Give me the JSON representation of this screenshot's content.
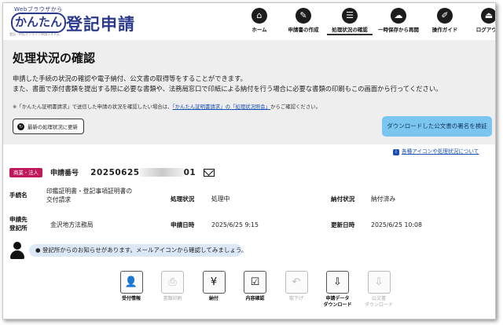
{
  "header": {
    "logo_small": "Webブラウザから",
    "logo_kantan": "かんたん",
    "logo_main": "登記申請",
    "logo_tiny": "登記・供託オンライン申請システム",
    "nav": [
      {
        "label": "ホーム",
        "icon": "home-icon"
      },
      {
        "label": "申請書の作成",
        "icon": "document-edit-icon"
      },
      {
        "label": "処理状況の確認",
        "icon": "list-check-icon",
        "active": true
      },
      {
        "label": "一時保存から再開",
        "icon": "cloud-download-icon"
      },
      {
        "label": "操作ガイド",
        "icon": "book-icon"
      },
      {
        "label": "ログアウト",
        "icon": "logout-icon"
      }
    ]
  },
  "page": {
    "title": "処理状況の確認",
    "desc_line1": "申請した手続の状況の確認や電子納付、公文書の取得等をすることができます。",
    "desc_line2": "また、書面で添付書類を提出する際に必要な書類や、法務局窓口で印紙による納付を行う場合に必要な書類の印刷もこの画面から行ってください。",
    "note_prefix": "※「かんたん証明書請求」で送信した申請の状況を確認したい場合は、",
    "note_link": "「かんたん証明書請求」の「処理状況照会」",
    "note_suffix": "からご確認ください。",
    "refresh_button": "最新の処理状況に更新",
    "verify_button": "ダウンロードした公文書の署名を検証",
    "help_link": "各種アイコンや処理状況について"
  },
  "application": {
    "badge": "商業・法人",
    "number_label": "申請番号",
    "number_prefix": "20250625",
    "number_suffix": "01",
    "fields": {
      "procedure_label": "手続名",
      "procedure_value_1": "印鑑証明書・登記事項証明書の",
      "procedure_value_2": "交付請求",
      "status_label": "処理状況",
      "status_value": "処理中",
      "payment_label": "納付状況",
      "payment_value": "納付済み",
      "office_label_1": "申請先",
      "office_label_2": "登記所",
      "office_value": "金沢地方法務局",
      "applied_label": "申請日時",
      "applied_value": "2025/6/25 9:15",
      "updated_label": "更新日時",
      "updated_value": "2025/6/25 10:08"
    },
    "notice": "登記所からのお知らせがあります。メールアイコンから確認してみましょう。"
  },
  "actions": [
    {
      "label_1": "受付情報",
      "label_2": "",
      "enabled": true,
      "icon": "person-icon"
    },
    {
      "label_1": "書類印刷",
      "label_2": "",
      "enabled": false,
      "icon": "printer-icon"
    },
    {
      "label_1": "納付",
      "label_2": "",
      "enabled": true,
      "icon": "yen-icon"
    },
    {
      "label_1": "内容確認",
      "label_2": "",
      "enabled": true,
      "icon": "document-search-icon"
    },
    {
      "label_1": "取下げ",
      "label_2": "",
      "enabled": false,
      "icon": "withdraw-icon"
    },
    {
      "label_1": "申請データ",
      "label_2": "ダウンロード",
      "enabled": true,
      "icon": "download-icon"
    },
    {
      "label_1": "公文書",
      "label_2": "ダウンロード",
      "enabled": false,
      "icon": "document-download-icon"
    }
  ],
  "colors": {
    "brand": "#2b3a8c",
    "badge": "#c2185b",
    "verify_button": "#7bc6f0",
    "notice_bg": "#dde8f7",
    "link": "#1a4fb0"
  }
}
